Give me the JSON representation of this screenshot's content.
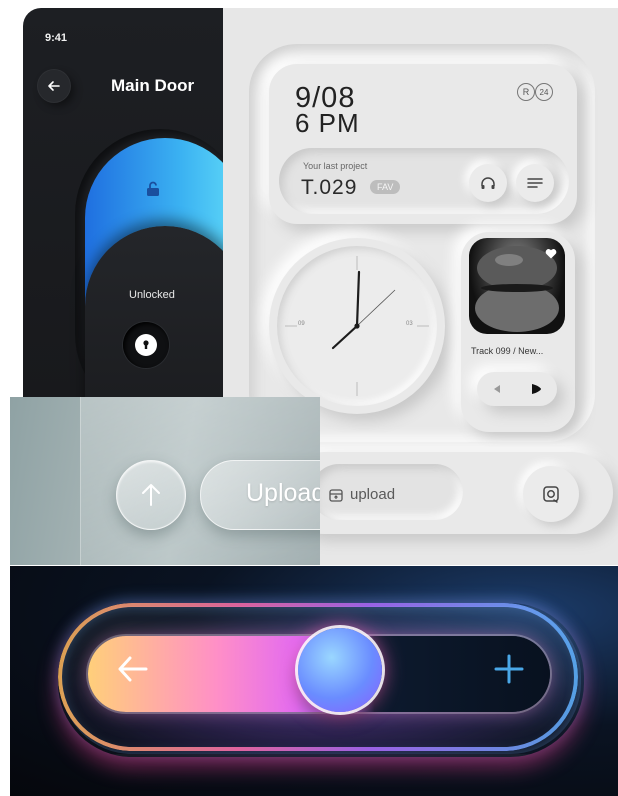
{
  "door_app": {
    "status_time": "9:41",
    "title": "Main Door",
    "status": "Unlocked"
  },
  "dashboard": {
    "date": "9/08",
    "time": "6 PM",
    "badges": [
      "R",
      "24"
    ],
    "project_label": "Your last project",
    "project_code": "T.029",
    "project_tag": "FAV",
    "clock": {
      "label_left": "09",
      "label_right": "03"
    },
    "track_title": "Track 099 / New...",
    "upload_label": "upload"
  },
  "glass_upload": {
    "label": "Upload"
  },
  "colors": {
    "door_accent": "#3bb2f2",
    "neo_background": "#e7e7e7",
    "neon_pink": "#ff6fb0",
    "neon_orange": "#ffb85a",
    "neon_blue": "#5fb4ff"
  },
  "icons": {
    "door_back": "arrow-left-icon",
    "door_lock_open": "unlocked-padlock-icon",
    "door_lock_button": "keyhole-icon",
    "dashboard_headphones": "headphones-icon",
    "dashboard_list": "list-icon",
    "dashboard_favorite": "heart-icon",
    "dashboard_prev": "previous-icon",
    "dashboard_play": "play-icon",
    "dashboard_upload": "upload-box-icon",
    "dashboard_side": "camera-icon",
    "glass_arrow": "arrow-up-icon",
    "neon_back": "arrow-left-icon",
    "neon_add": "plus-icon"
  }
}
